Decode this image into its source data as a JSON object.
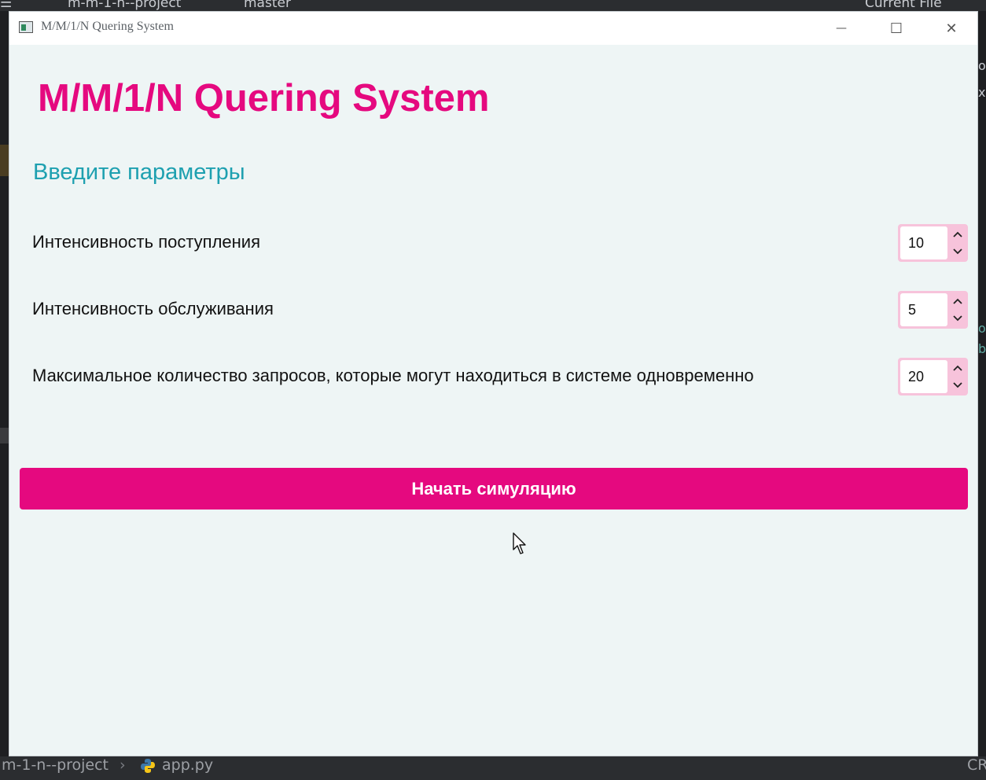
{
  "ide": {
    "top_project": "m-m-1-n--project",
    "top_branch": "master",
    "top_run_config": "Current File",
    "bottom_project": "m-1-n--project",
    "bottom_file": "app.py",
    "bottom_right": "CR"
  },
  "window": {
    "title": "M/M/1/N Quering System",
    "minimize_glyph": "—",
    "maximize_glyph": "☐",
    "close_glyph": "✕"
  },
  "app": {
    "heading": "M/M/1/N Quering System",
    "section_title": "Введите параметры",
    "params": [
      {
        "label": "Интенсивность поступления",
        "value": "10"
      },
      {
        "label": "Интенсивность обслуживания",
        "value": "5"
      },
      {
        "label": "Максимальное количество запросов, которые могут находиться в системе одновременно",
        "value": "20"
      }
    ],
    "start_button": "Начать симуляцию"
  },
  "colors": {
    "accent": "#e5097f",
    "section": "#1ea0b0",
    "spin_bg": "#f7c3db",
    "background": "#eef5f5"
  },
  "icons": {
    "app_icon": "window-app-icon",
    "spin_up": "chevron-up-icon",
    "spin_down": "chevron-down-icon",
    "cursor": "mouse-pointer-icon",
    "python": "python-icon"
  }
}
